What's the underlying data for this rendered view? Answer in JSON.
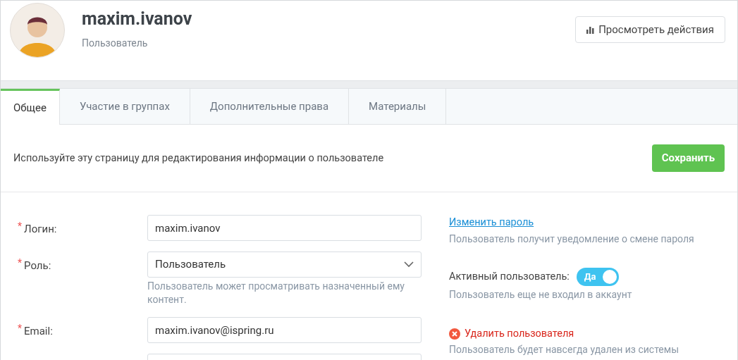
{
  "header": {
    "username": "maxim.ivanov",
    "role": "Пользователь",
    "actions_button": "Просмотреть действия"
  },
  "tabs": [
    {
      "label": "Общее",
      "selected": true
    },
    {
      "label": "Участие в группах",
      "selected": false
    },
    {
      "label": "Дополнительные права",
      "selected": false
    },
    {
      "label": "Материалы",
      "selected": false
    }
  ],
  "intro": "Используйте эту страницу для редактирования информации о пользователе",
  "save_button": "Сохранить",
  "fields": [
    {
      "kind": "text",
      "label": "Логин:",
      "required_mark": "*",
      "value": "maxim.ivanov"
    },
    {
      "kind": "select",
      "label": "Роль:",
      "required_mark": "*",
      "value": "Пользователь",
      "hint": "Пользователь может просматривать назначенный ему контент."
    },
    {
      "kind": "text",
      "label": "Email:",
      "required_mark": "*",
      "value": "maxim.ivanov@ispring.ru"
    },
    {
      "kind": "text"
    }
  ],
  "password": {
    "link": "Изменить пароль",
    "hint": "Пользователь получит уведомление о смене пароля"
  },
  "active": {
    "label": "Активный пользователь:",
    "on": true,
    "on_text": "Да",
    "hint": "Пользователь еще не входил в аккаунт"
  },
  "delete": {
    "link": "Удалить пользователя",
    "hint": "Пользователь будет навсегда удален из системы"
  }
}
